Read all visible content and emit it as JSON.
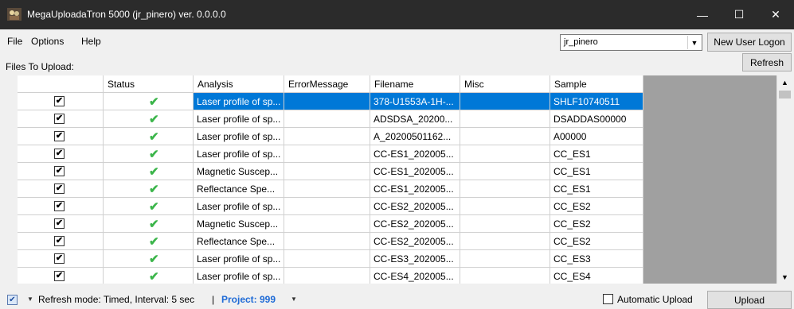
{
  "window": {
    "title": "MegaUploadaTron 5000 (jr_pinero) ver. 0.0.0.0",
    "min_glyph": "—",
    "max_glyph": "☐",
    "close_glyph": "✕"
  },
  "menu": {
    "file": "File",
    "options": "Options",
    "help": "Help"
  },
  "user": {
    "selected": "jr_pinero",
    "new_user_label": "New User Logon"
  },
  "files": {
    "label": "Files To Upload:",
    "refresh_label": "Refresh"
  },
  "table": {
    "columns": [
      "Status",
      "Analysis",
      "ErrorMessage",
      "Filename",
      "Misc",
      "Sample"
    ],
    "rows": [
      {
        "checked": true,
        "status": "✔",
        "analysis": "Laser profile of sp...",
        "error": "",
        "filename": "378-U1553A-1H-...",
        "misc": "",
        "sample": "SHLF10740511",
        "selected": true
      },
      {
        "checked": true,
        "status": "✔",
        "analysis": "Laser profile of sp...",
        "error": "",
        "filename": "ADSDSA_20200...",
        "misc": "",
        "sample": "DSADDAS00000",
        "selected": false
      },
      {
        "checked": true,
        "status": "✔",
        "analysis": "Laser profile of sp...",
        "error": "",
        "filename": "A_20200501162...",
        "misc": "",
        "sample": "A00000",
        "selected": false
      },
      {
        "checked": true,
        "status": "✔",
        "analysis": "Laser profile of sp...",
        "error": "",
        "filename": "CC-ES1_202005...",
        "misc": "",
        "sample": "CC_ES1",
        "selected": false
      },
      {
        "checked": true,
        "status": "✔",
        "analysis": "Magnetic Suscep...",
        "error": "",
        "filename": "CC-ES1_202005...",
        "misc": "",
        "sample": "CC_ES1",
        "selected": false
      },
      {
        "checked": true,
        "status": "✔",
        "analysis": "Reflectance Spe...",
        "error": "",
        "filename": "CC-ES1_202005...",
        "misc": "",
        "sample": "CC_ES1",
        "selected": false
      },
      {
        "checked": true,
        "status": "✔",
        "analysis": "Laser profile of sp...",
        "error": "",
        "filename": "CC-ES2_202005...",
        "misc": "",
        "sample": "CC_ES2",
        "selected": false
      },
      {
        "checked": true,
        "status": "✔",
        "analysis": "Magnetic Suscep...",
        "error": "",
        "filename": "CC-ES2_202005...",
        "misc": "",
        "sample": "CC_ES2",
        "selected": false
      },
      {
        "checked": true,
        "status": "✔",
        "analysis": "Reflectance Spe...",
        "error": "",
        "filename": "CC-ES2_202005...",
        "misc": "",
        "sample": "CC_ES2",
        "selected": false
      },
      {
        "checked": true,
        "status": "✔",
        "analysis": "Laser profile of sp...",
        "error": "",
        "filename": "CC-ES3_202005...",
        "misc": "",
        "sample": "CC_ES3",
        "selected": false
      },
      {
        "checked": true,
        "status": "✔",
        "analysis": "Laser profile of sp...",
        "error": "",
        "filename": "CC-ES4_202005...",
        "misc": "",
        "sample": "CC_ES4",
        "selected": false
      }
    ]
  },
  "status": {
    "refresh_mode": "Refresh mode: Timed, Interval: 5 sec",
    "separator": "|",
    "project": "Project:  999",
    "auto_upload_label": "Automatic Upload",
    "upload_label": "Upload"
  },
  "colors": {
    "selection": "#0078d7",
    "check_green": "#3bb54a",
    "project_blue": "#1f6bd6",
    "titlebar": "#2b2b2b"
  }
}
